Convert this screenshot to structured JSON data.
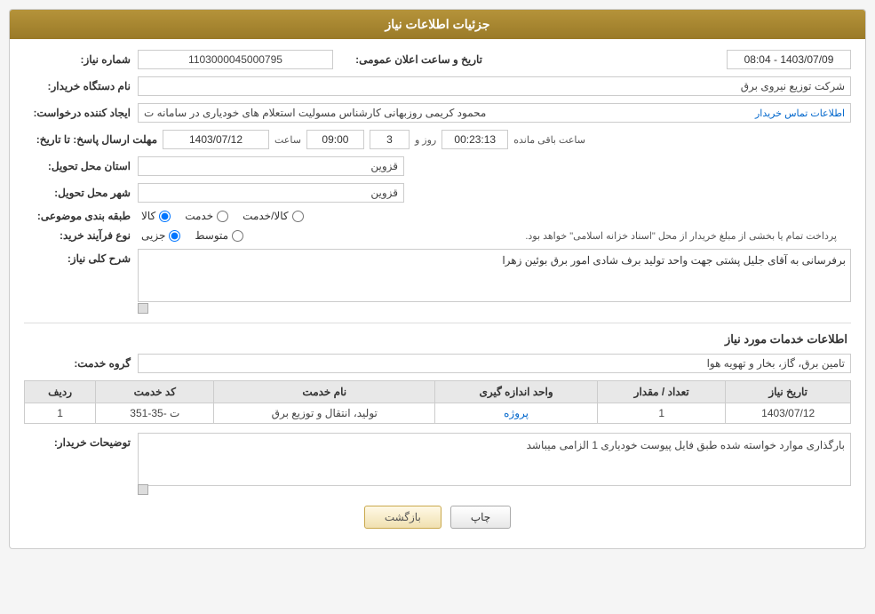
{
  "page": {
    "title": "جزئیات اطلاعات نیاز"
  },
  "header": {
    "shmare_label": "شماره نیاز:",
    "shmare_value": "1103000045000795",
    "namdast_label": "نام دستگاه خریدار:",
    "namdast_value": "شرکت توزیع نیروی برق",
    "creator_label": "ایجاد کننده درخواست:",
    "creator_value": "محمود کریمی روزبهانی کارشناس  مسولیت استعلام های خودیاری در سامانه ت",
    "creator_link": "اطلاعات تماس خریدار",
    "mohlet_label": "مهلت ارسال پاسخ: تا تاریخ:",
    "mohlet_date": "1403/07/12",
    "mohlet_time_label": "ساعت",
    "mohlet_time": "09:00",
    "mohlet_days_label": "روز و",
    "mohlet_days": "3",
    "mohlet_remaining_label": "ساعت باقی مانده",
    "mohlet_remaining": "00:23:13",
    "date_label": "تاریخ و ساعت اعلان عمومی:",
    "date_value": "1403/07/09 - 08:04",
    "ostan_label": "استان محل تحویل:",
    "ostan_value": "قزوین",
    "shahr_label": "شهر محل تحویل:",
    "shahr_value": "قزوین",
    "tabagheh_label": "طبقه بندی موضوعی:",
    "tabagheh_kala": "کالا",
    "tabagheh_khadamat": "خدمت",
    "tabagheh_kala_khadamat": "کالا/خدمت",
    "noefar_label": "نوع فرآیند خرید:",
    "noefar_jozee": "جزیی",
    "noefar_motavasset": "متوسط",
    "noefar_text": "پرداخت تمام یا بخشی از مبلغ خریدار از محل \"اسناد خزانه اسلامی\" خواهد بود.",
    "sharh_label": "شرح کلی نیاز:",
    "sharh_value": "برفرسانی به آقای جلیل پشتی جهت واحد تولید برف شادی امور برق بوئین زهرا"
  },
  "khadamat_section": {
    "title": "اطلاعات خدمات مورد نیاز",
    "grooh_label": "گروه خدمت:",
    "grooh_value": "تامین برق، گاز، بخار و تهویه هوا",
    "table": {
      "headers": [
        "ردیف",
        "کد خدمت",
        "نام خدمت",
        "واحد اندازه گیری",
        "تعداد / مقدار",
        "تاریخ نیاز"
      ],
      "rows": [
        {
          "radif": "1",
          "kod": "ت -35-351",
          "nam": "تولید، انتقال و توزیع برق",
          "vahed": "پروژه",
          "tedad": "1",
          "tarikh": "1403/07/12"
        }
      ]
    }
  },
  "tozihat": {
    "label": "توضیحات خریدار:",
    "value": "بارگذاری موارد خواسته شده طبق فایل پیوست خودیاری 1 الزامی میباشد"
  },
  "buttons": {
    "print": "چاپ",
    "back": "بازگشت"
  }
}
